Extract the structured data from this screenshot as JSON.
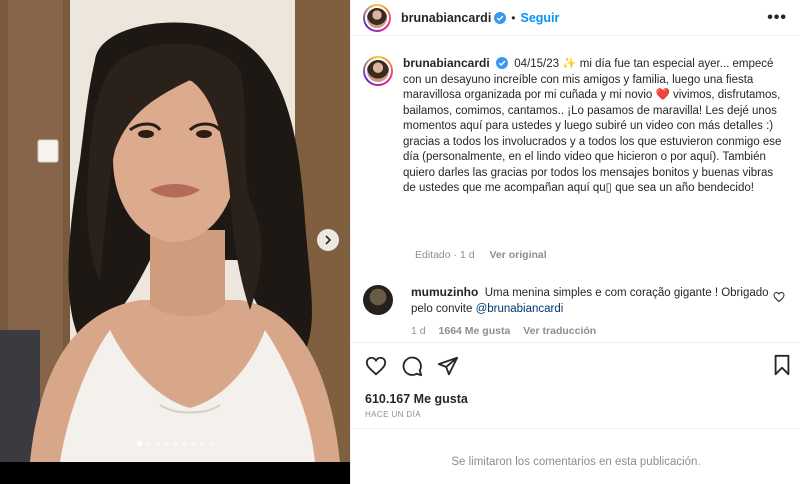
{
  "post": {
    "username": "brunabiancardi",
    "follow_label": "Seguir",
    "more_label": "•••",
    "separator": "•"
  },
  "caption": {
    "username": "brunabiancardi",
    "text": "04/15/23 ✨ mi día fue tan especial ayer... empecé con un desayuno increíble con mis amigos y familia, luego una fiesta maravillosa organizada por mi cuñada y mi novio ❤️ vivimos, disfrutamos, bailamos, comimos, cantamos.. ¡Lo pasamos de maravilla! Les dejé unos momentos aquí para ustedes y luego subiré un video con más detalles :) gracias a todos los involucrados y a todos los que estuvieron conmigo ese día (personalmente, en el lindo video que hicieron o por aquí). También quiero darles las gracias por todos los mensajes bonitos y buenas vibras de ustedes que me acompañan aquí qu▯ que sea un año bendecido!",
    "edited": "Editado · 1 d",
    "see_original": "Ver original"
  },
  "comment": {
    "username": "mumuzinho",
    "text": "Uma menina simples e com coração gigante ! Obrigado pelo convite ",
    "mention": "@brunabiancardi",
    "age": "1 d",
    "likes": "1664 Me gusta",
    "translate": "Ver traducción"
  },
  "stats": {
    "likes": "610.167 Me gusta",
    "date": "HACE UN DÍA"
  },
  "footer": {
    "limited": "Se limitaron los comentarios en esta publicación."
  },
  "carousel": {
    "slides": 9,
    "active_index": 0
  },
  "colors": {
    "accent": "#0095f6",
    "verified": "#3897f0",
    "muted": "#8e8e8e",
    "text": "#262626"
  },
  "icons": [
    "chevron-right-icon",
    "verified-badge-icon",
    "heart-icon",
    "comment-icon",
    "share-icon",
    "bookmark-icon",
    "more-icon"
  ]
}
